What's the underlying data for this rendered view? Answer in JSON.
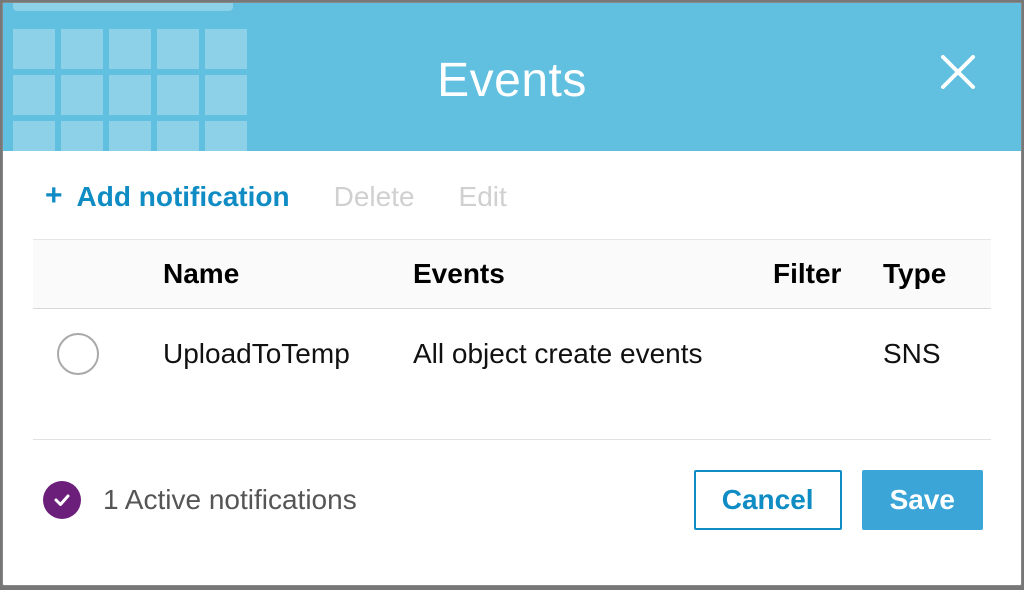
{
  "header": {
    "title": "Events"
  },
  "actions": {
    "add_label": "Add notification",
    "delete_label": "Delete",
    "edit_label": "Edit"
  },
  "table": {
    "headers": {
      "name": "Name",
      "events": "Events",
      "filter": "Filter",
      "type": "Type"
    },
    "rows": [
      {
        "name": "UploadToTemp",
        "events": "All object create events",
        "filter": "",
        "type": "SNS"
      }
    ]
  },
  "footer": {
    "status_text": "1 Active notifications",
    "cancel_label": "Cancel",
    "save_label": "Save"
  },
  "colors": {
    "header_bg": "#61bfe0",
    "accent": "#0f8cc4",
    "save_bg": "#3ca5d8",
    "badge_bg": "#6b1e7a"
  }
}
